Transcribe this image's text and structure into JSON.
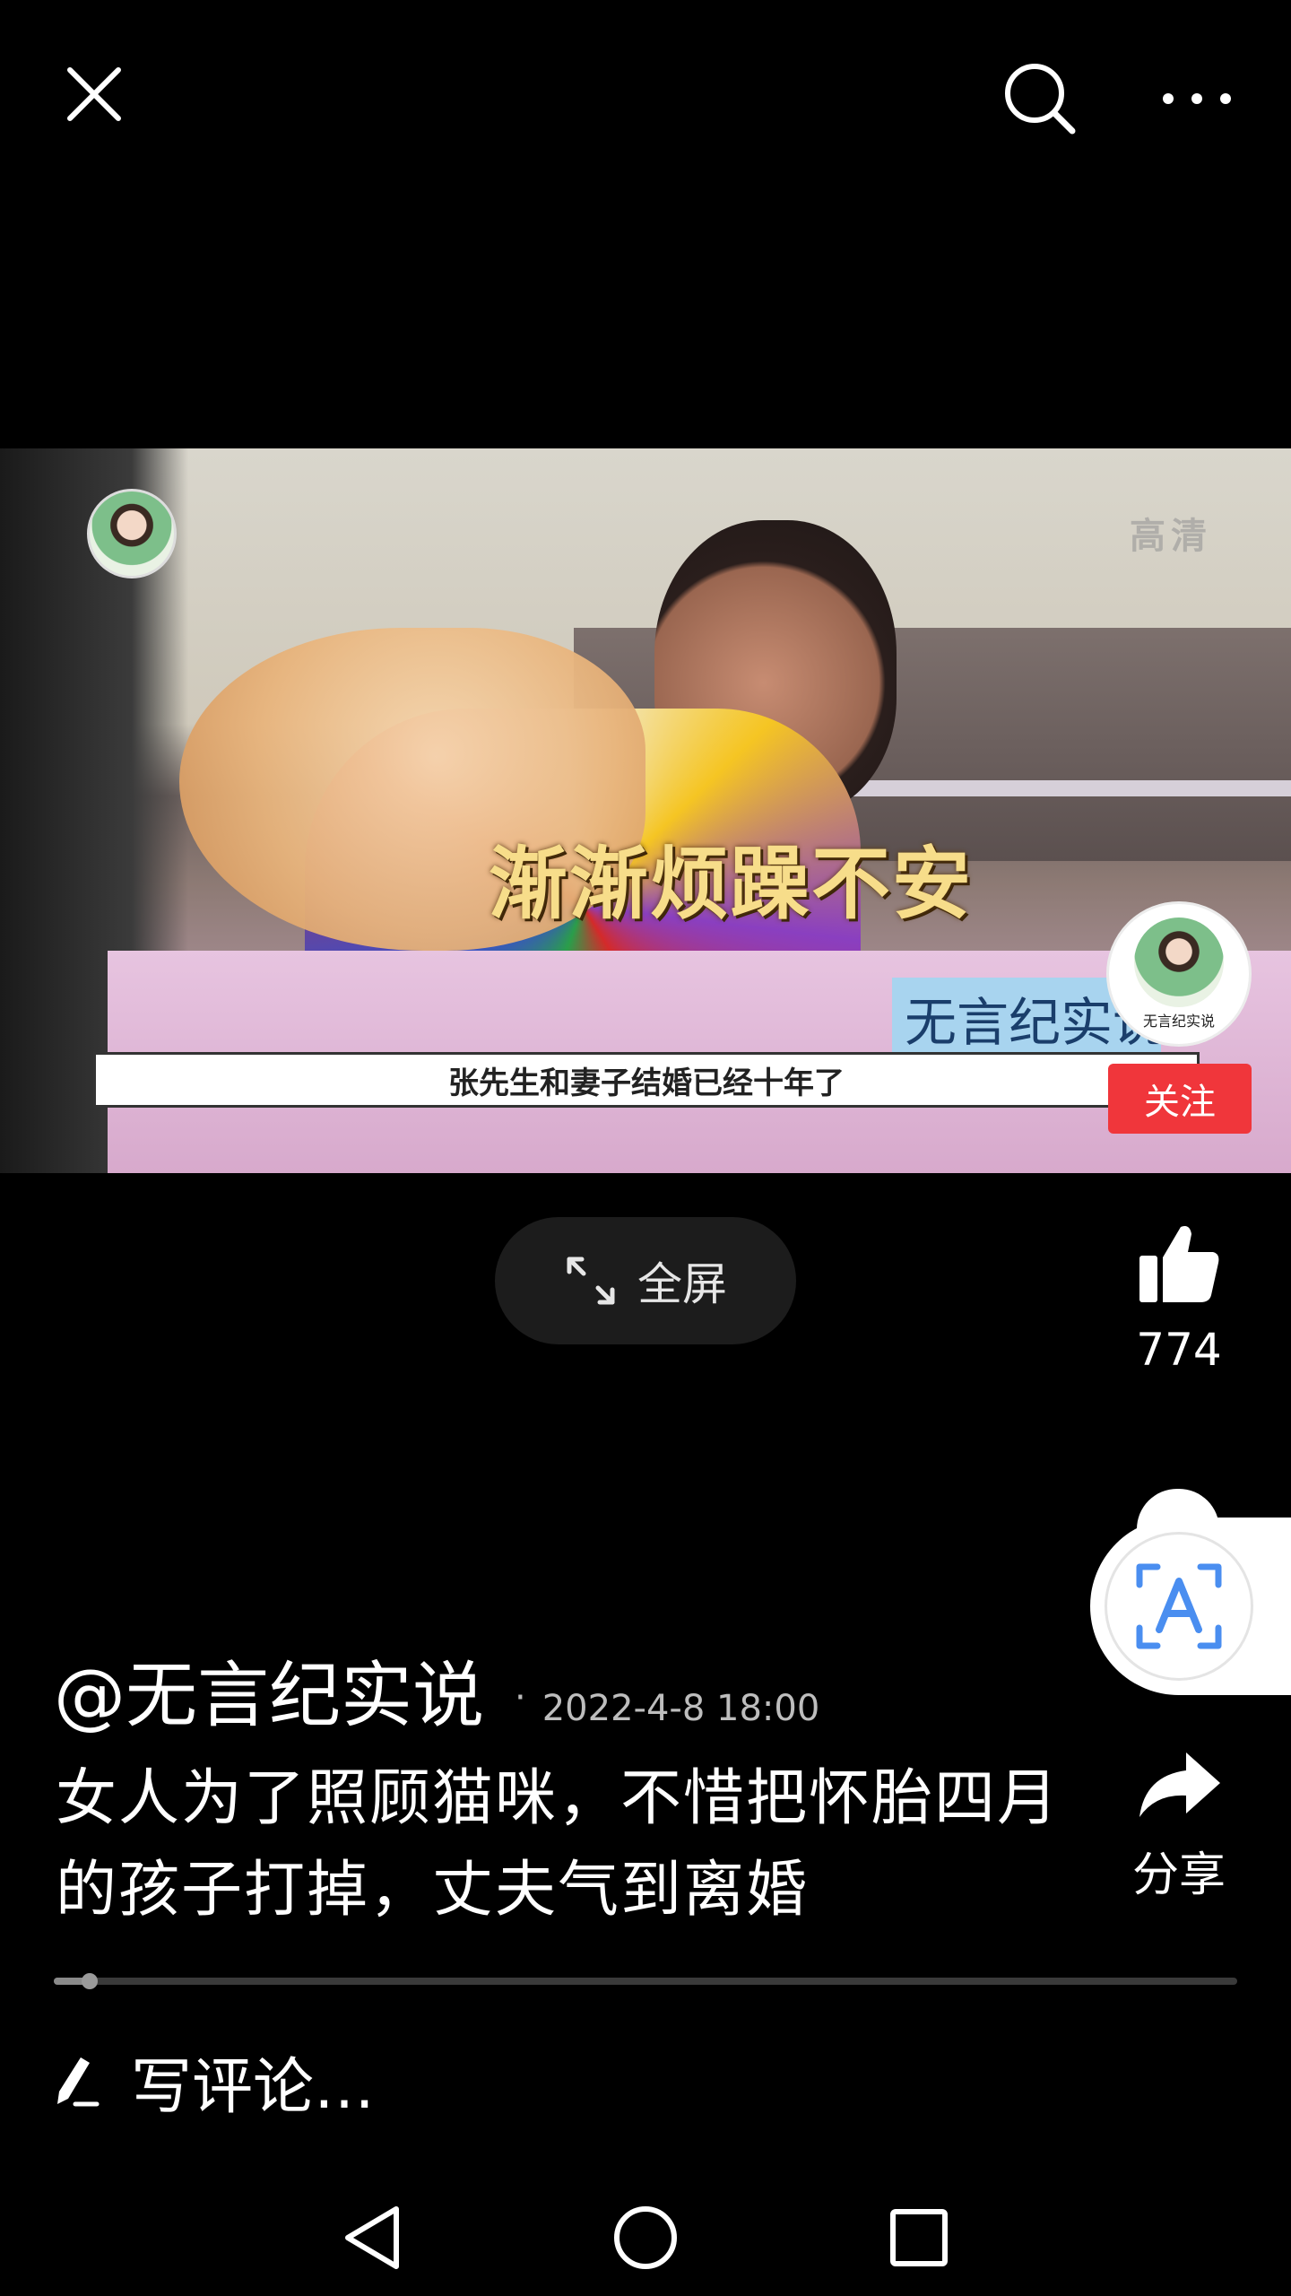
{
  "topbar": {
    "close_icon": "close-icon",
    "search_icon": "search-icon",
    "more_icon": "more-icon"
  },
  "video": {
    "quality_label": "高清",
    "caption": "渐渐烦躁不安",
    "subtitle": "张先生和妻子结婚已经十年了",
    "watermark": "无言纪实说"
  },
  "fullscreen": {
    "label": "全屏",
    "icon": "expand-icon"
  },
  "sidebar": {
    "avatar_name": "无言纪实说",
    "follow_label": "关注",
    "like_count": "774",
    "share_label": "分享"
  },
  "post": {
    "author": "@无言纪实说",
    "separator": "·",
    "timestamp": "2022-4-8 18:00",
    "title": "女人为了照顾猫咪，不惜把怀胎四月的孩子打掉，丈夫气到离婚"
  },
  "progress": {
    "fraction": 0.03
  },
  "comment": {
    "placeholder": "写评论…",
    "icon": "pen-icon"
  },
  "navbar": {
    "back_icon": "back-icon",
    "home_icon": "home-icon",
    "recents_icon": "recents-icon"
  },
  "colors": {
    "background": "#000000",
    "follow": "#f0363b",
    "accent_blue": "#4a8ef0"
  }
}
